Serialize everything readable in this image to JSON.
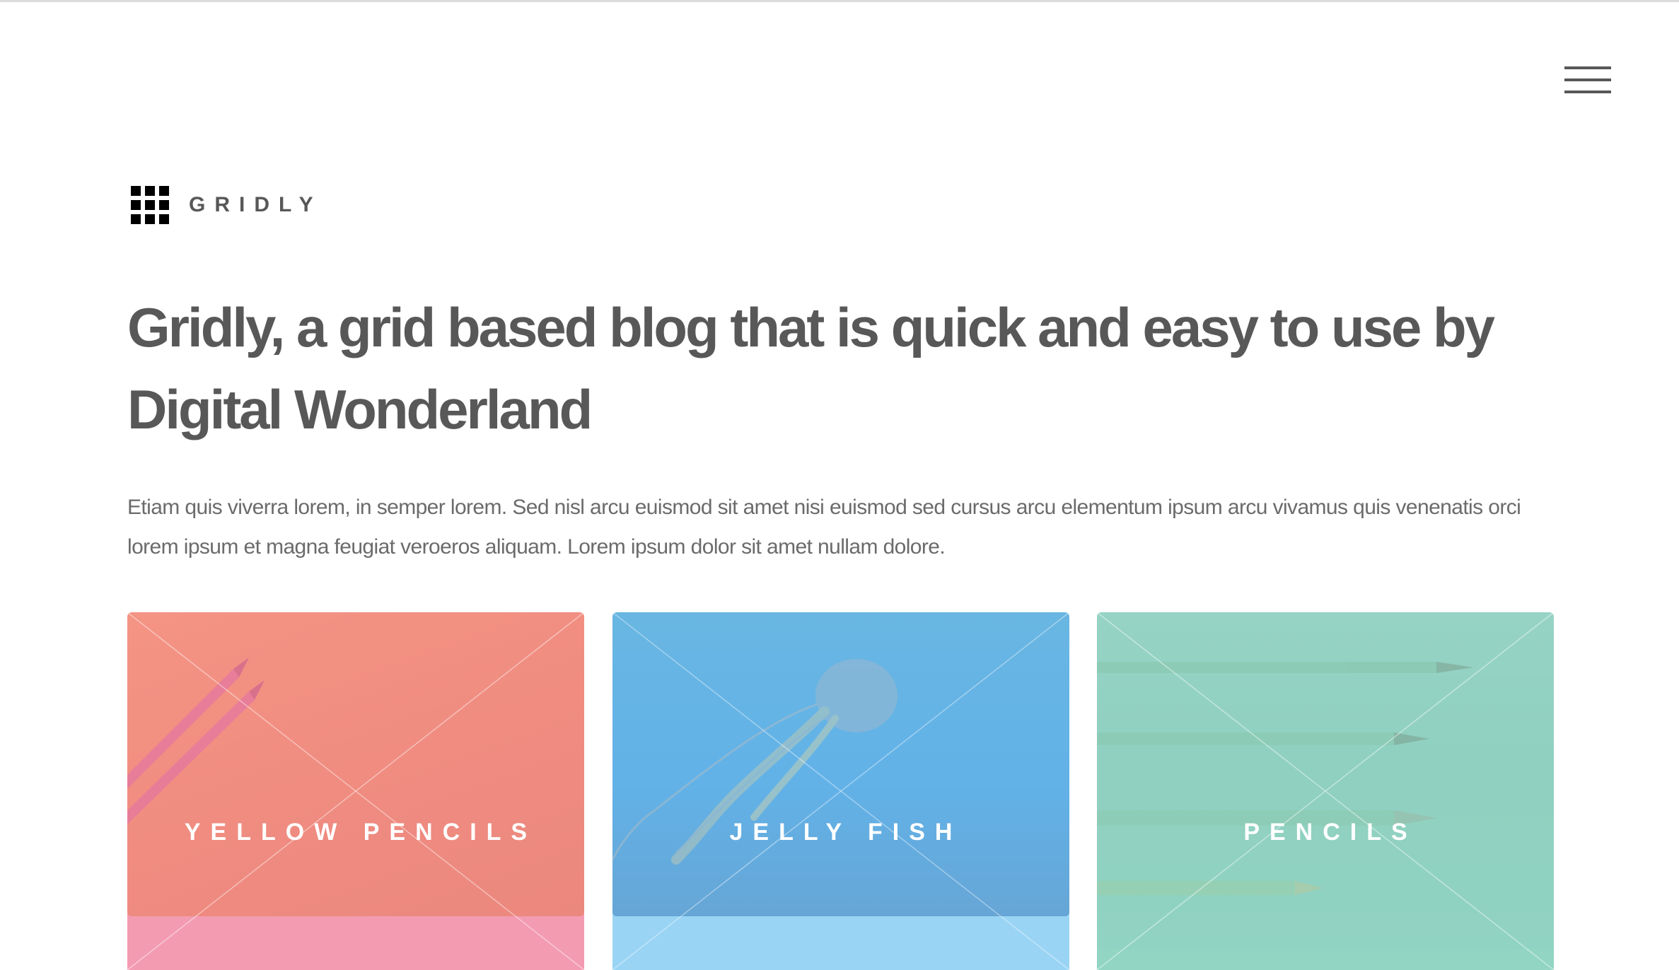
{
  "site": {
    "logo_text": "GRIDLY"
  },
  "header": {
    "menu_icon": "hamburger-menu-icon"
  },
  "hero": {
    "headline": "Gridly, a grid based blog that is quick and easy to use by Digital Wonderland",
    "intro": "Etiam quis viverra lorem, in semper lorem. Sed nisl arcu euismod sit amet nisi euismod sed cursus arcu elementum ipsum arcu vivamus quis venenatis orci lorem ipsum et magna feugiat veroeros aliquam. Lorem ipsum dolor sit amet nullam dolore."
  },
  "cards": [
    {
      "title": "YELLOW PENCILS",
      "overlay_color": "#ef8b80",
      "base_color": "#f39bb1"
    },
    {
      "title": "JELLY FISH",
      "overlay_color": "#62b2e8",
      "base_color": "#9ad4f4"
    },
    {
      "title": "PENCILS",
      "overlay_color": "#8fd0c0",
      "base_color": "#91d5c2"
    }
  ]
}
